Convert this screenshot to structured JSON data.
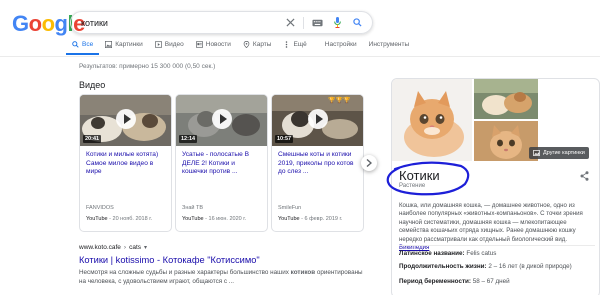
{
  "header": {
    "logo": [
      "G",
      "o",
      "o",
      "g",
      "l",
      "e"
    ],
    "logo_colors": [
      "#4285f4",
      "#ea4335",
      "#fbbc05",
      "#4285f4",
      "#34a853",
      "#ea4335"
    ],
    "query": "котики"
  },
  "tabs": [
    {
      "label": "Все",
      "icon": "search-icon"
    },
    {
      "label": "Картинки",
      "icon": "image-icon"
    },
    {
      "label": "Видео",
      "icon": "video-icon"
    },
    {
      "label": "Новости",
      "icon": "news-icon"
    },
    {
      "label": "Карты",
      "icon": "map-pin-icon"
    },
    {
      "label": "Ещё",
      "icon": "more-icon"
    },
    {
      "label": "Настройки",
      "icon": ""
    },
    {
      "label": "Инструменты",
      "icon": ""
    }
  ],
  "stats": "Результатов: примерно 15 300 000 (0,50 сек.)",
  "videos": {
    "heading": "Видео",
    "items": [
      {
        "duration": "20:41",
        "title": "Котики и милые котята) Самое милое видео в мире",
        "source": "FANVIDOS",
        "platform": "YouTube",
        "date": "20 нояб. 2018 г."
      },
      {
        "duration": "12:14",
        "title": "Усатые - полосатые В ДЕЛЕ 2! Котики и кошечки против ...",
        "source": "Знай ТВ",
        "platform": "YouTube",
        "date": "16 июн. 2020 г."
      },
      {
        "duration": "10:57",
        "title": "Смешные коты и котики 2019, приколы про котов до слез ...",
        "source": "SmileFun",
        "platform": "YouTube",
        "date": "6 февр. 2019 г."
      }
    ]
  },
  "result": {
    "url": "www.koto.cafe",
    "path": "cats",
    "title": "Котики | kotissimo - Котокафе \"Котиссимо\"",
    "snippet_1": "Несмотря на сложные судьбы и разные характеры большинство наших",
    "snippet_bold": "котиков",
    "snippet_2": "ориентированы на человека, с удовольствием играют, общаются с ..."
  },
  "knowledge_panel": {
    "more_images": "Другие картинки",
    "title": "Котики",
    "subtitle": "Растение",
    "description": "Кошка, или домашняя кошка, — домашнее животное, одно из наиболее популярных «животных-компаньонов». С точки зрения научной систематики, домашняя кошка — млекопитающее семейства кошачьих отряда хищных. Ранее домашнюю кошку нередко рассматривали как отдельный биологический вид.",
    "source_link": "Википедия",
    "facts": [
      {
        "label": "Латинское название:",
        "value": "Felis catus"
      },
      {
        "label": "Продолжительность жизни:",
        "value": "2 – 16 лет (в дикой природе)"
      },
      {
        "label": "Период беременности:",
        "value": "58 – 67 дней"
      }
    ]
  }
}
